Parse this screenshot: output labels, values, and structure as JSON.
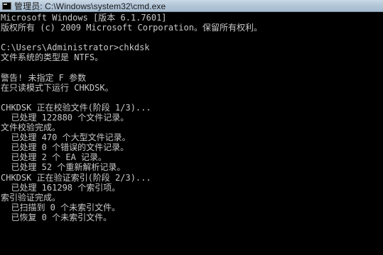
{
  "window": {
    "title": "管理员: C:\\Windows\\system32\\cmd.exe",
    "icon": "cmd-icon"
  },
  "console": {
    "lines": [
      "Microsoft Windows [版本 6.1.7601]",
      "版权所有 (c) 2009 Microsoft Corporation。保留所有权利。",
      "",
      "C:\\Users\\Administrator>chkdsk",
      "文件系统的类型是 NTFS。",
      "",
      "警告! 未指定 F 参数",
      "在只读模式下运行 CHKDSK。",
      "",
      "CHKDSK 正在校验文件(阶段 1/3)...",
      "  已处理 122880 个文件记录。",
      "文件校验完成。",
      "  已处理 470 个大型文件记录。",
      "  已处理 0 个错误的文件记录。",
      "  已处理 2 个 EA 记录。",
      "  已处理 52 个重新解析记录。",
      "CHKDSK 正在验证索引(阶段 2/3)...",
      "  已处理 161298 个索引项。",
      "索引验证完成。",
      "  已扫描到 0 个未索引文件。",
      "  已恢复 0 个未索引文件。"
    ]
  }
}
